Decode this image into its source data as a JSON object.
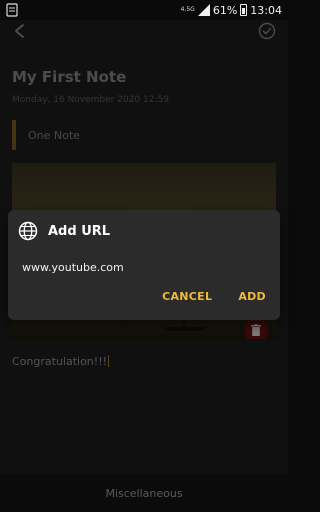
{
  "status_bar": {
    "network": "4.5G",
    "network_top": "4.5G",
    "battery": "61%",
    "time": "13:04"
  },
  "toolbar": {
    "back_icon": "arrow-back-icon",
    "done_icon": "check-circle-icon"
  },
  "note": {
    "title": "My First Note",
    "date": "Monday, 16 November 2020 12:59",
    "notebook": "One Note",
    "body": "Congratulation!!!"
  },
  "bottom_bar": {
    "label": "Miscellaneous"
  },
  "dialog": {
    "icon": "globe-icon",
    "title": "Add URL",
    "url_value": "www.youtube.com",
    "cancel_label": "CANCEL",
    "add_label": "ADD"
  },
  "colors": {
    "accent": "#f0b93a",
    "notebook_bar": "#7b6120",
    "delete_button": "#6a1212",
    "dialog_bg": "#2b2b2b"
  }
}
